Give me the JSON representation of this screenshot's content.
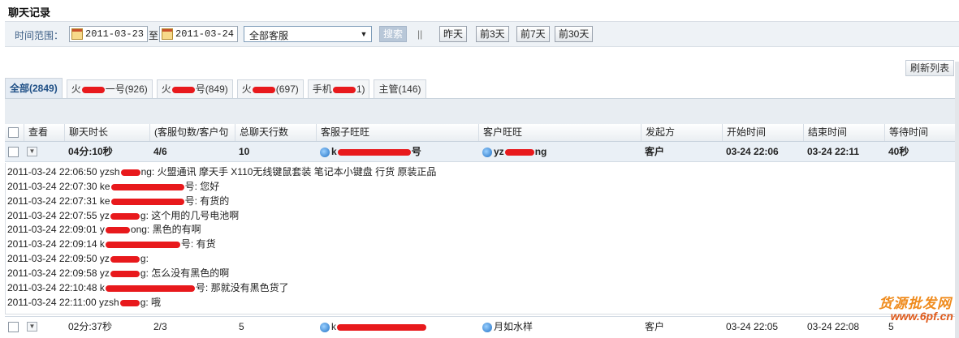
{
  "page_title": "聊天记录",
  "filter": {
    "label": "时间范围：",
    "start_date": "2011-03-23",
    "to_label": "至",
    "end_date": "2011-03-24",
    "agent_select": "全部客服",
    "search_button": "搜索",
    "separator": "||",
    "quick_buttons": [
      "昨天",
      "前3天",
      "前7天",
      "前30天"
    ]
  },
  "refresh_button": "刷新列表",
  "tabs": [
    {
      "pre": "全部(2849)",
      "post": "",
      "redacted": false,
      "active": true
    },
    {
      "pre": "火",
      "post": "一号(926)",
      "redacted": true,
      "active": false
    },
    {
      "pre": "火",
      "post": "号(849)",
      "redacted": true,
      "active": false
    },
    {
      "pre": "火",
      "post": "(697)",
      "redacted": true,
      "active": false
    },
    {
      "pre": "手机",
      "post": "1)",
      "redacted": true,
      "active": false
    },
    {
      "pre": "主管(146)",
      "post": "",
      "redacted": false,
      "active": false
    }
  ],
  "columns": [
    "查看",
    "聊天时长",
    "(客服句数/客户句",
    "总聊天行数",
    "客服子旺旺",
    "客户旺旺",
    "发起方",
    "开始时间",
    "结束时间",
    "等待时间"
  ],
  "rows": [
    {
      "duration": "04分:10秒",
      "ratio": "4/6",
      "lines": "10",
      "agent_pre": "k",
      "agent_post": "号",
      "customer_pre": "yz",
      "customer_post": "ng",
      "initiator": "客户",
      "start": "03-24 22:06",
      "end": "03-24 22:11",
      "wait": "40秒"
    },
    {
      "duration": "02分:37秒",
      "ratio": "2/3",
      "lines": "5",
      "agent_pre": "k",
      "agent_post": "",
      "customer_pre": "月如水样",
      "customer_post": "",
      "initiator": "客户",
      "start": "03-24 22:05",
      "end": "03-24 22:08",
      "wait": "5"
    }
  ],
  "messages": [
    {
      "time": "2011-03-24 22:06:50",
      "pre": "yzsh",
      "post": "ng:",
      "text": "火盟通讯 摩天手 X110无线键鼠套装 笔记本小键盘 行货 原装正品"
    },
    {
      "time": "2011-03-24 22:07:30",
      "pre": "ke",
      "post": "号:",
      "text": "您好"
    },
    {
      "time": "2011-03-24 22:07:31",
      "pre": "ke",
      "post": "号:",
      "text": "有货的"
    },
    {
      "time": "2011-03-24 22:07:55",
      "pre": "yz",
      "post": "g:",
      "text": "这个用的几号电池啊"
    },
    {
      "time": "2011-03-24 22:09:01",
      "pre": "y",
      "post": "ong:",
      "text": "黑色的有啊"
    },
    {
      "time": "2011-03-24 22:09:14",
      "pre": "k",
      "post": "号:",
      "text": "有货"
    },
    {
      "time": "2011-03-24 22:09:50",
      "pre": "yz",
      "post": "g:",
      "text": ""
    },
    {
      "time": "2011-03-24 22:09:58",
      "pre": "yz",
      "post": "g:",
      "text": "怎么没有黑色的啊"
    },
    {
      "time": "2011-03-24 22:10:48",
      "pre": "k",
      "post": "号:",
      "text": "那就没有黑色货了"
    },
    {
      "time": "2011-03-24 22:11:00",
      "pre": "yzsh",
      "post": "g:",
      "text": "哦"
    }
  ],
  "watermark": {
    "line1": "货源批发网",
    "line2": "www.6pf.cn"
  }
}
